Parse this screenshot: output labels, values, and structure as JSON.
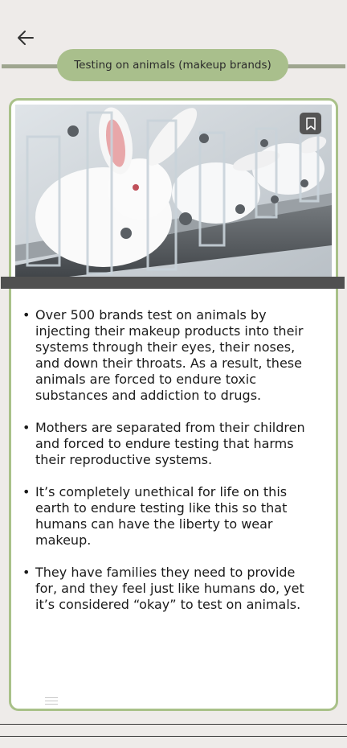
{
  "header": {
    "back_icon": "arrow-left-icon",
    "title": "Testing on animals (makeup brands)"
  },
  "card": {
    "image_alt": "White rabbits restrained in clear plastic stocks in a laboratory",
    "bookmark_icon": "bookmark-icon",
    "bullets": [
      "Over 500 brands test on animals by injecting their makeup products into their systems through their eyes, their noses, and down their throats. As a result, these animals are forced to endure toxic substances and addiction to drugs.",
      "Mothers are separated from their children and forced to endure testing that harms their reproductive systems.",
      "It’s completely unethical for life on this earth to endure testing like this so that humans can have the liberty to wear makeup.",
      "They have families they need to provide for, and they feel just like humans do, yet it’s considered “okay” to test on animals."
    ]
  },
  "colors": {
    "accent": "#a9bf8c",
    "card_border": "#a9c189",
    "background": "#eeebe9"
  }
}
